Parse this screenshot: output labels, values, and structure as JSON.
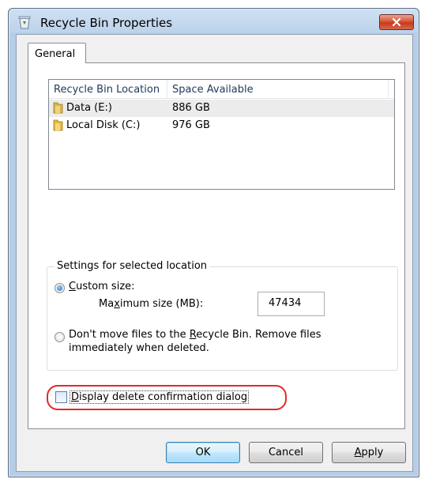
{
  "window": {
    "title": "Recycle Bin Properties"
  },
  "tabs": [
    {
      "label": "General"
    }
  ],
  "location_list": {
    "columns": [
      "Recycle Bin Location",
      "Space Available"
    ],
    "rows": [
      {
        "location": "Data (E:)",
        "space": "886 GB",
        "selected": true
      },
      {
        "location": "Local Disk (C:)",
        "space": "976 GB",
        "selected": false
      }
    ]
  },
  "settings": {
    "group_label": "Settings for selected location",
    "custom_size": {
      "label_prefix": "",
      "label_access_key": "C",
      "label_rest": "ustom size:",
      "checked": true
    },
    "max_size": {
      "label_prefix": "Ma",
      "label_access_key": "x",
      "label_rest": "imum size (MB):",
      "value": "47434"
    },
    "dont_move": {
      "line1_prefix": "Don't move files to the ",
      "line1_access_key": "R",
      "line1_rest": "ecycle Bin. Remove files",
      "line2": "immediately when deleted.",
      "checked": false
    }
  },
  "confirm_checkbox": {
    "access_key": "D",
    "label_rest": "isplay delete confirmation dialog",
    "checked": false,
    "highlight_color": "#e02a2a"
  },
  "buttons": {
    "ok": "OK",
    "cancel": "Cancel",
    "apply_access_key": "A",
    "apply_rest": "pply"
  }
}
